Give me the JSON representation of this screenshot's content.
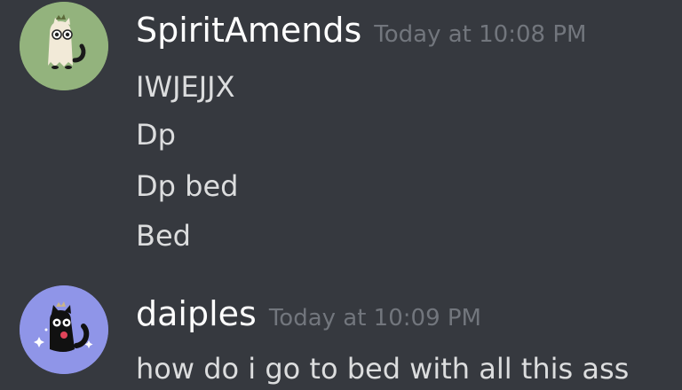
{
  "messages": [
    {
      "username": "SpiritAmends",
      "timestamp": "Today at 10:08 PM",
      "avatar_color": "#93b37d",
      "avatar_icon": "ghost-cat-icon",
      "lines": [
        "IWJEJJX",
        "Dp",
        "Dp bed",
        "Bed"
      ]
    },
    {
      "username": "daiples",
      "timestamp": "Today at 10:09 PM",
      "avatar_color": "#8f95e8",
      "avatar_icon": "black-cat-icon",
      "lines": [
        "how do i go to bed with all this ass"
      ]
    }
  ],
  "colors": {
    "background": "#36393f",
    "username": "#ffffff",
    "timestamp": "#72767d",
    "text": "#dcddde"
  }
}
